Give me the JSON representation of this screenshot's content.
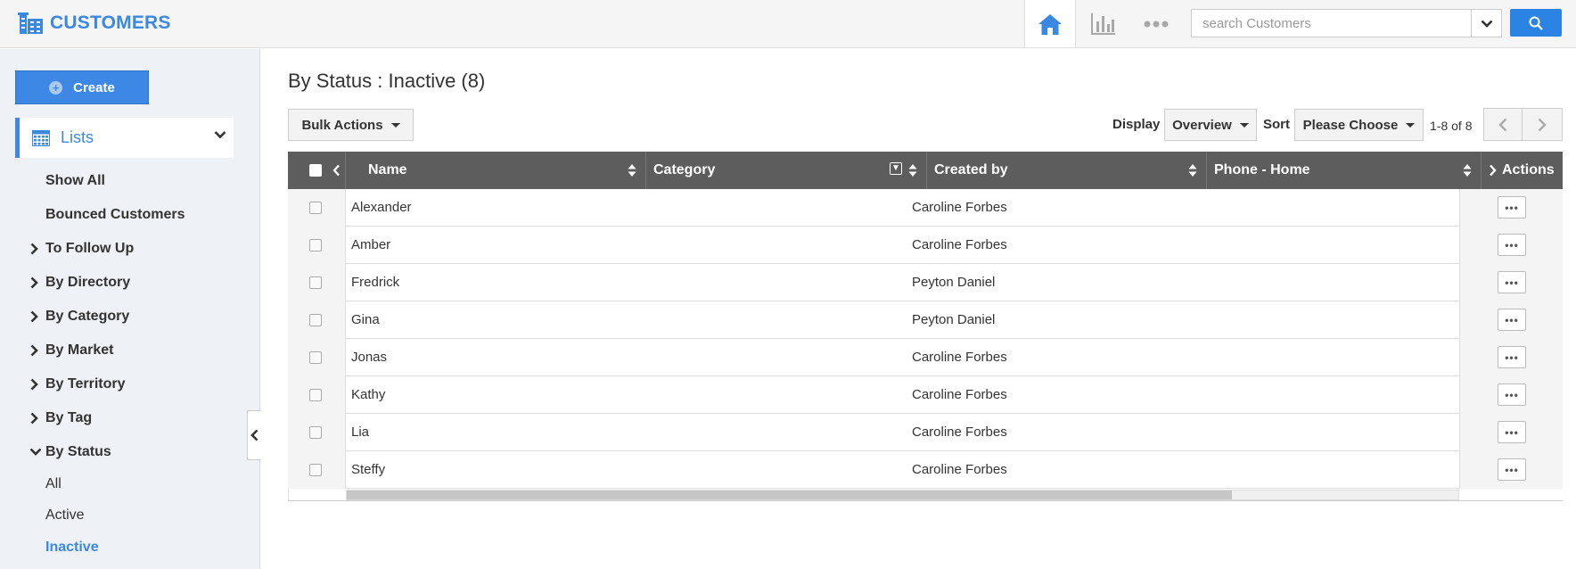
{
  "header": {
    "title": "CUSTOMERS",
    "search_placeholder": "search Customers",
    "icons": [
      "building-logo-icon",
      "home-icon",
      "bar-chart-icon",
      "more-dots-icon",
      "chevron-down-icon",
      "search-icon"
    ],
    "accent_color": "#3b88e0"
  },
  "sidebar": {
    "create_label": "Create",
    "lists_label": "Lists",
    "items": [
      {
        "label": "Show All",
        "expandable": false
      },
      {
        "label": "Bounced Customers",
        "expandable": false
      },
      {
        "label": "To Follow Up",
        "expandable": true
      },
      {
        "label": "By Directory",
        "expandable": true
      },
      {
        "label": "By Category",
        "expandable": true
      },
      {
        "label": "By Market",
        "expandable": true
      },
      {
        "label": "By Territory",
        "expandable": true
      },
      {
        "label": "By Tag",
        "expandable": true
      },
      {
        "label": "By Status",
        "expandable": true,
        "expanded": true
      }
    ],
    "status_sub": [
      {
        "label": "All"
      },
      {
        "label": "Active"
      },
      {
        "label": "Inactive",
        "selected": true
      }
    ]
  },
  "main": {
    "page_title": "By Status : Inactive (8)",
    "bulk_actions_label": "Bulk Actions",
    "display_label": "Display",
    "display_value": "Overview",
    "sort_label": "Sort",
    "sort_value": "Please Choose",
    "pager_text": "1-8 of 8"
  },
  "table": {
    "columns": [
      "Name",
      "Category",
      "Created by",
      "Phone - Home",
      "Actions"
    ],
    "rows": [
      {
        "name": "Alexander",
        "category": "",
        "created_by": "Caroline Forbes",
        "phone": ""
      },
      {
        "name": "Amber",
        "category": "",
        "created_by": "Caroline Forbes",
        "phone": ""
      },
      {
        "name": "Fredrick",
        "category": "",
        "created_by": "Peyton Daniel",
        "phone": ""
      },
      {
        "name": "Gina",
        "category": "",
        "created_by": "Peyton Daniel",
        "phone": ""
      },
      {
        "name": "Jonas",
        "category": "",
        "created_by": "Caroline Forbes",
        "phone": ""
      },
      {
        "name": "Kathy",
        "category": "",
        "created_by": "Caroline Forbes",
        "phone": ""
      },
      {
        "name": "Lia",
        "category": "",
        "created_by": "Caroline Forbes",
        "phone": ""
      },
      {
        "name": "Steffy",
        "category": "",
        "created_by": "Caroline Forbes",
        "phone": ""
      }
    ]
  }
}
